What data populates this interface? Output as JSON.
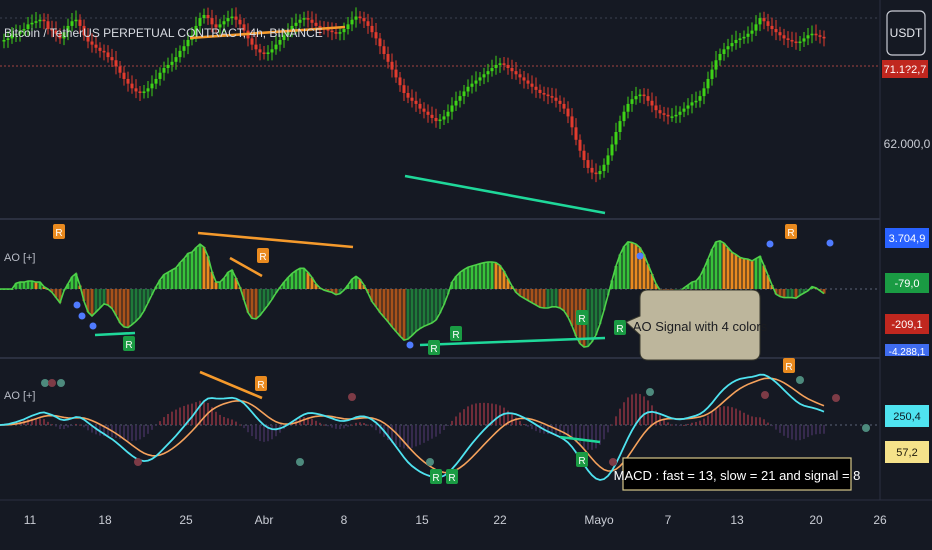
{
  "header": {
    "symbol_title": "Bitcoin / TetherUS PERPETUAL CONTRACT, 4h, BINANCE",
    "currency_button": "USDT"
  },
  "colors": {
    "background": "#151923",
    "bull": "#3ed317",
    "bear": "#e23b2e",
    "divergence_bear": "#f59a2c",
    "divergence_bull": "#1fd89a",
    "ao_dark_green": "#1f7a3a",
    "ao_light_green": "#38c23a",
    "ao_orange": "#e98a1f",
    "ao_dark_orange": "#a8521a",
    "macd_line": "#4fe3f0",
    "signal_line": "#f6a25c"
  },
  "chart_data": [
    {
      "type": "line",
      "name": "price",
      "title": "Bitcoin / TetherUS PERPETUAL CONTRACT, 4h, BINANCE",
      "x_tick_labels": [
        "11",
        "18",
        "25",
        "Abr",
        "8",
        "15",
        "22",
        "Mayo",
        "7",
        "13",
        "20",
        "26"
      ],
      "ylim": [
        60000,
        72500
      ],
      "y_tick_labels": [
        "62.000,0"
      ],
      "price_badge": "71.1?2,7",
      "x": [
        0,
        4,
        8,
        12,
        16,
        20,
        24,
        28,
        32,
        36,
        40,
        44,
        48,
        52,
        56,
        60,
        64,
        68,
        72,
        76,
        80,
        84,
        88,
        92,
        96,
        100,
        104,
        108,
        112,
        116,
        120,
        124,
        128,
        132,
        136,
        140,
        144,
        148,
        152,
        156,
        160,
        164,
        168,
        172,
        176,
        180,
        184,
        188,
        192,
        196,
        200,
        204,
        208,
        212,
        216,
        220,
        224,
        228,
        232,
        236,
        240,
        244,
        248,
        252,
        256,
        260,
        264,
        268,
        272,
        276,
        280,
        284,
        288,
        292,
        296,
        300,
        304,
        308,
        312,
        316,
        320,
        324,
        328,
        332,
        336,
        340,
        344,
        348,
        352,
        356,
        360,
        364,
        368,
        372,
        376,
        380,
        384,
        388,
        392,
        396,
        400,
        404,
        408,
        412,
        416,
        420,
        424,
        428,
        432,
        436,
        440,
        444,
        448,
        452,
        456,
        460,
        464,
        468,
        472,
        476,
        480,
        484,
        488,
        492,
        496,
        500,
        504,
        508,
        512,
        516,
        520,
        524,
        528,
        532,
        536,
        540,
        544,
        548,
        552,
        556,
        560,
        564,
        568,
        572,
        576,
        580,
        584,
        588,
        592,
        596,
        600,
        604,
        608,
        612,
        616,
        620,
        624,
        628,
        632,
        636,
        640,
        644,
        648,
        652,
        656,
        660,
        664,
        668,
        672,
        676,
        680,
        684,
        688,
        692,
        696,
        700,
        704,
        708,
        712,
        716,
        720,
        724,
        728,
        732,
        736,
        740,
        744,
        748,
        752,
        756,
        760,
        764,
        768,
        772,
        776,
        780,
        784,
        788,
        792,
        796,
        800,
        804,
        808,
        812,
        816,
        820,
        824,
        828,
        832,
        836,
        840,
        844,
        848,
        852,
        856,
        860,
        864,
        868,
        872,
        876,
        880
      ],
      "series": [
        {
          "name": "close",
          "values": [
            70800,
            70900,
            71000,
            71200,
            71300,
            71500,
            71600,
            71900,
            72000,
            72100,
            72200,
            72100,
            71600,
            71500,
            71300,
            71000,
            71400,
            71800,
            72100,
            72200,
            71800,
            71200,
            70800,
            70600,
            70400,
            70200,
            70100,
            69800,
            69600,
            69200,
            68800,
            68400,
            68100,
            67800,
            67600,
            67500,
            67600,
            67800,
            68100,
            68400,
            68800,
            69100,
            69300,
            69500,
            69800,
            70200,
            70500,
            70900,
            71200,
            71800,
            72300,
            72500,
            72300,
            71900,
            71700,
            71900,
            72100,
            72300,
            72400,
            72200,
            71900,
            71500,
            71000,
            70600,
            70300,
            70100,
            70000,
            70100,
            70300,
            70600,
            70900,
            71200,
            71500,
            71800,
            72000,
            72200,
            72300,
            72200,
            72000,
            71800,
            71700,
            71600,
            71500,
            71400,
            71300,
            71400,
            71600,
            71900,
            72200,
            72400,
            72300,
            72100,
            71800,
            71400,
            71000,
            70500,
            70000,
            69500,
            69000,
            68500,
            68000,
            67500,
            67200,
            67000,
            66800,
            66500,
            66300,
            66100,
            65900,
            65700,
            65800,
            66000,
            66300,
            66700,
            67000,
            67300,
            67600,
            67900,
            68100,
            68300,
            68500,
            68700,
            68900,
            69100,
            69300,
            69400,
            69300,
            69100,
            68900,
            68700,
            68500,
            68300,
            68100,
            67900,
            67700,
            67500,
            67400,
            67300,
            67200,
            67000,
            66800,
            66500,
            66000,
            65300,
            64500,
            63800,
            63200,
            62700,
            62400,
            62300,
            62500,
            62900,
            63500,
            64200,
            65000,
            65700,
            66300,
            66800,
            67100,
            67300,
            67400,
            67300,
            67000,
            66700,
            66400,
            66200,
            66100,
            66000,
            66000,
            66100,
            66300,
            66500,
            66700,
            66900,
            67000,
            67300,
            67800,
            68400,
            69000,
            69600,
            70000,
            70300,
            70500,
            70700,
            70900,
            71000,
            71100,
            71300,
            71500,
            71900,
            72300,
            72100,
            71800,
            71600,
            71400,
            71200,
            71000,
            70900,
            70800,
            70700,
            70800,
            71000,
            71200,
            71300,
            71200,
            71100,
            71000
          ]
        }
      ],
      "annotations": [
        "divergence lines"
      ]
    },
    {
      "type": "bar",
      "name": "ao",
      "title": "AO [+]",
      "ylim": [
        -4500,
        4500
      ],
      "values_badges": [
        "3.704,9",
        "-79,0",
        "-209,1",
        "-4.288,1"
      ],
      "callout": "AO Signal with 4 colors",
      "markers": [
        "R",
        "R",
        "R",
        "R",
        "R",
        "R",
        "R",
        "R"
      ]
    },
    {
      "type": "line",
      "name": "macd",
      "title": "AO [+]",
      "values_badges": [
        "250,4",
        "57,2"
      ],
      "callout": "MACD : fast = 13, slow = 21 and signal = 8",
      "markers": [
        "R",
        "R",
        "R",
        "R",
        "R"
      ],
      "series": [
        {
          "name": "",
          "values": []
        },
        {
          "name": "",
          "values": []
        }
      ]
    }
  ]
}
